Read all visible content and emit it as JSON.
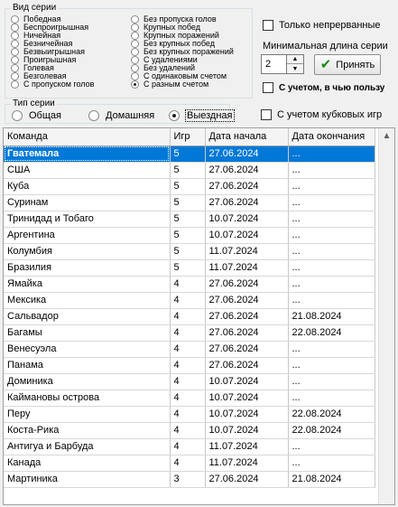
{
  "series_kind": {
    "title": "Вид серии",
    "left": [
      {
        "label": "Победная",
        "checked": false
      },
      {
        "label": "Беспроигрышная",
        "checked": false
      },
      {
        "label": "Ничейная",
        "checked": false
      },
      {
        "label": "Безничейная",
        "checked": false
      },
      {
        "label": "Безвыигрышная",
        "checked": false
      },
      {
        "label": "Проигрышная",
        "checked": false
      },
      {
        "label": "Голевая",
        "checked": false
      },
      {
        "label": "Безголевая",
        "checked": false
      },
      {
        "label": "С пропуском голов",
        "checked": false
      }
    ],
    "right": [
      {
        "label": "Без пропуска голов",
        "checked": false
      },
      {
        "label": "Крупных побед",
        "checked": false
      },
      {
        "label": "Крупных поражений",
        "checked": false
      },
      {
        "label": "Без крупных побед",
        "checked": false
      },
      {
        "label": "Без крупных поражений",
        "checked": false
      },
      {
        "label": "С удалениями",
        "checked": false
      },
      {
        "label": "Без удалений",
        "checked": false
      },
      {
        "label": "С одинаковым счетом",
        "checked": false
      },
      {
        "label": "С разным счетом",
        "checked": true
      }
    ]
  },
  "options": {
    "continuous_label": "Только непрерванные",
    "min_length_label": "Минимальная длина серии",
    "min_length_value": "2",
    "accept_label": "Принять",
    "advantage_label": "С учетом, в чью пользу",
    "cup_games_label": "С учетом кубковых игр"
  },
  "series_type": {
    "title": "Тип серии",
    "options": [
      {
        "label": "Общая",
        "checked": false
      },
      {
        "label": "Домашняя",
        "checked": false
      },
      {
        "label": "Выездная",
        "checked": true
      }
    ]
  },
  "table": {
    "columns": [
      "Команда",
      "Игр",
      "Дата начала",
      "Дата окончания"
    ],
    "rows": [
      [
        "Гватемала",
        "5",
        "27.06.2024",
        "..."
      ],
      [
        "США",
        "5",
        "27.06.2024",
        "..."
      ],
      [
        "Куба",
        "5",
        "27.06.2024",
        "..."
      ],
      [
        "Суринам",
        "5",
        "27.06.2024",
        "..."
      ],
      [
        "Тринидад и Тобаго",
        "5",
        "10.07.2024",
        "..."
      ],
      [
        "Аргентина",
        "5",
        "10.07.2024",
        "..."
      ],
      [
        "Колумбия",
        "5",
        "11.07.2024",
        "..."
      ],
      [
        "Бразилия",
        "5",
        "11.07.2024",
        "..."
      ],
      [
        "Ямайка",
        "4",
        "27.06.2024",
        "..."
      ],
      [
        "Мексика",
        "4",
        "27.06.2024",
        "..."
      ],
      [
        "Сальвадор",
        "4",
        "27.06.2024",
        "21.08.2024"
      ],
      [
        "Багамы",
        "4",
        "27.06.2024",
        "22.08.2024"
      ],
      [
        "Венесуэла",
        "4",
        "27.06.2024",
        "..."
      ],
      [
        "Панама",
        "4",
        "27.06.2024",
        "..."
      ],
      [
        "Доминика",
        "4",
        "10.07.2024",
        "..."
      ],
      [
        "Каймановы острова",
        "4",
        "10.07.2024",
        "..."
      ],
      [
        "Перу",
        "4",
        "10.07.2024",
        "22.08.2024"
      ],
      [
        "Коста-Рика",
        "4",
        "10.07.2024",
        "22.08.2024"
      ],
      [
        "Антигуа и Барбуда",
        "4",
        "11.07.2024",
        "..."
      ],
      [
        "Канада",
        "4",
        "11.07.2024",
        "..."
      ],
      [
        "Мартиника",
        "3",
        "27.06.2024",
        "21.08.2024"
      ]
    ],
    "selected_row": 0
  }
}
